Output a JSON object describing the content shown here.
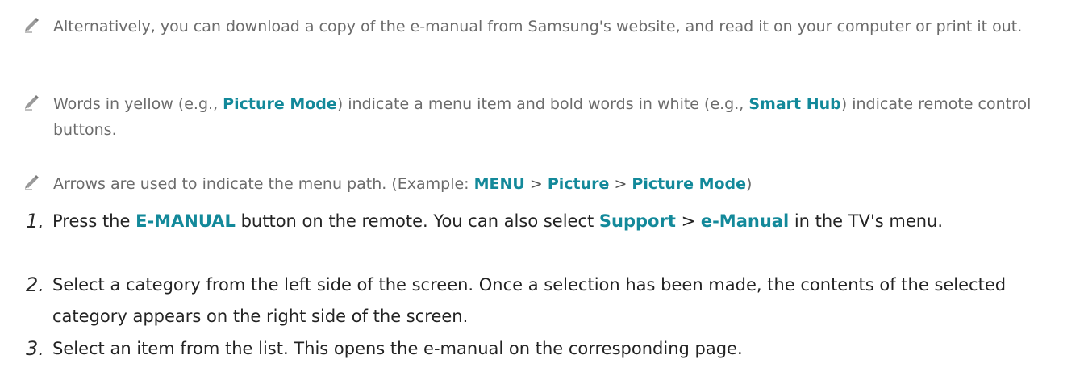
{
  "notes": [
    {
      "icon": "pencil-icon",
      "text": "Alternatively, you can download a copy of the e-manual from Samsung's website, and read it on your computer or print it out."
    },
    {
      "icon": "pencil-icon",
      "parts": {
        "a": "Words in yellow (e.g., ",
        "b": "Picture Mode",
        "c": ") indicate a menu item and bold words in white (e.g., ",
        "d": "Smart Hub",
        "e": ") indicate remote control buttons."
      }
    },
    {
      "icon": "pencil-icon",
      "parts": {
        "a": "Arrows are used to indicate the menu path. (Example: ",
        "b": "MENU",
        "sep1": " > ",
        "c": "Picture",
        "sep2": " > ",
        "d": "Picture Mode",
        "e": ")"
      }
    }
  ],
  "steps": [
    {
      "num": "1.",
      "parts": {
        "a": "Press the ",
        "b": "E-MANUAL",
        "c": " button on the remote. You can also select ",
        "d": "Support",
        "sep": " > ",
        "e": "e-Manual",
        "f": " in the TV's menu."
      }
    },
    {
      "num": "2.",
      "text": "Select a category from the left side of the screen. Once a selection has been made, the contents of the selected category appears on the right side of the screen."
    },
    {
      "num": "3.",
      "text": "Select an item from the list. This opens the e-manual on the corresponding page."
    }
  ],
  "colors": {
    "highlight": "#13899a",
    "note_text": "#6b6b6b",
    "step_text": "#232323"
  }
}
